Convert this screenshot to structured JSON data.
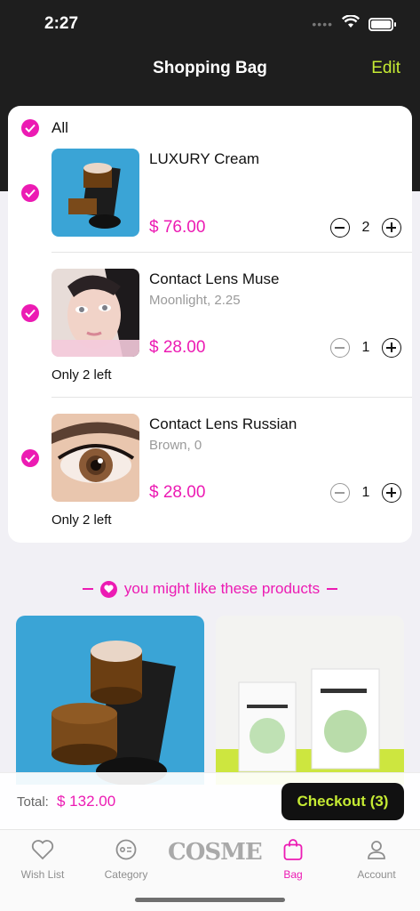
{
  "status": {
    "time": "2:27",
    "dots": "••••"
  },
  "nav": {
    "title": "Shopping Bag",
    "edit": "Edit"
  },
  "cart": {
    "all_label": "All",
    "items": [
      {
        "name": "LUXURY Cream",
        "variant": "",
        "price": "$ 76.00",
        "qty": "2",
        "stock": ""
      },
      {
        "name": "Contact Lens Muse",
        "variant": "Moonlight, 2.25",
        "price": "$ 28.00",
        "qty": "1",
        "stock": "Only 2 left"
      },
      {
        "name": "Contact Lens Russian",
        "variant": "Brown, 0",
        "price": "$ 28.00",
        "qty": "1",
        "stock": "Only 2 left"
      }
    ]
  },
  "suggestions": {
    "title": "you might like these products"
  },
  "footer": {
    "total_label": "Total:",
    "total_value": "$ 132.00",
    "checkout": "Checkout (3)"
  },
  "tabs": [
    {
      "label": "Wish List",
      "icon": "heart-icon"
    },
    {
      "label": "Category",
      "icon": "category-icon"
    },
    {
      "label": "COSME",
      "icon": "logo"
    },
    {
      "label": "Bag",
      "icon": "bag-icon"
    },
    {
      "label": "Account",
      "icon": "user-icon"
    }
  ],
  "colors": {
    "accent": "#ec1bb3",
    "lime": "#c5ea33",
    "dark": "#1e1e1e"
  }
}
